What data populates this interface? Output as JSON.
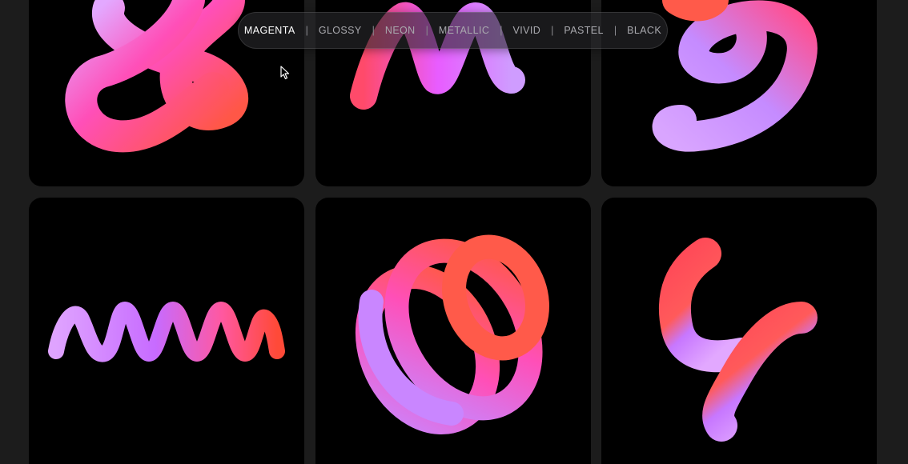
{
  "filter_bar": {
    "items": [
      {
        "label": "MAGENTA",
        "active": true
      },
      {
        "label": "GLOSSY",
        "active": false
      },
      {
        "label": "NEON",
        "active": false
      },
      {
        "label": "METALLIC",
        "active": false
      },
      {
        "label": "VIVID",
        "active": false
      },
      {
        "label": "PASTEL",
        "active": false
      },
      {
        "label": "BLACK",
        "active": false
      }
    ],
    "separator": "|"
  },
  "gallery": {
    "tiles": [
      {
        "icon": "knot-ampersand-shape"
      },
      {
        "icon": "zigzag-m-shape"
      },
      {
        "icon": "curl-spiral-shape"
      },
      {
        "icon": "coil-spring-shape"
      },
      {
        "icon": "tangled-loops-shape"
      },
      {
        "icon": "hook-squiggle-shape"
      }
    ]
  },
  "colors": {
    "background": "#1c1c1c",
    "tile": "#000000",
    "gradient_pink": "#ff4fb0",
    "gradient_coral": "#ff5a4e",
    "gradient_violet": "#b27bff",
    "gradient_lilac": "#e0a6ff"
  }
}
